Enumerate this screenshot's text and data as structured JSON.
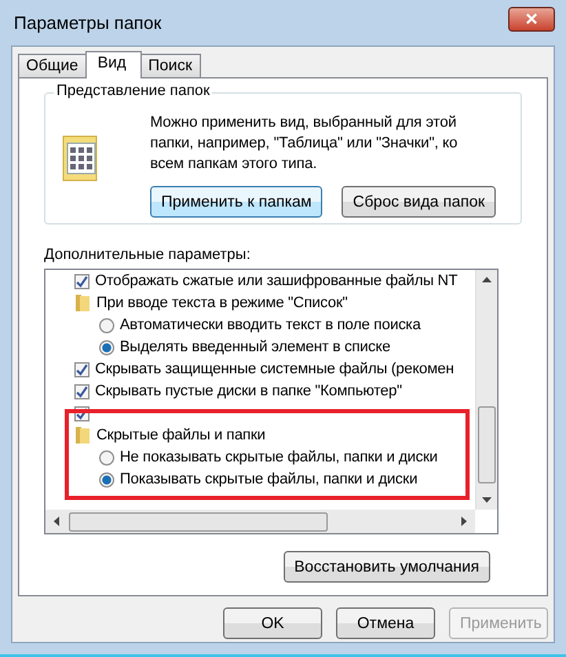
{
  "window": {
    "title": "Параметры папок",
    "close": "✕"
  },
  "tabs": [
    {
      "label": "Общие",
      "selected": false
    },
    {
      "label": "Вид",
      "selected": true
    },
    {
      "label": "Поиск",
      "selected": false
    }
  ],
  "folder_view": {
    "title": "Представление папок",
    "text": "Можно применить вид, выбранный для этой папки, например, \"Таблица\" или \"Значки\", ко всем папкам этого типа.",
    "buttons": [
      {
        "label": "Применить к папкам",
        "focused": true
      },
      {
        "label": "Сброс вида папок",
        "focused": false
      }
    ]
  },
  "advanced": {
    "label": "Дополнительные параметры:",
    "items": [
      {
        "kind": "checkbox",
        "label": "Отображать сжатые или зашифрованные файлы NT",
        "checked": true
      },
      {
        "kind": "folder",
        "label": "При вводе текста в режиме \"Список\"",
        "children": [
          {
            "kind": "radio",
            "label": "Автоматически вводить текст в поле поиска",
            "selected": false
          },
          {
            "kind": "radio",
            "label": "Выделять введенный элемент в списке",
            "selected": true
          }
        ]
      },
      {
        "kind": "checkbox",
        "label": "Скрывать защищенные системные файлы (рекомен",
        "checked": true
      },
      {
        "kind": "checkbox",
        "label": "Скрывать пустые диски в папке \"Компьютер\"",
        "checked": true
      },
      {
        "kind": "checkbox",
        "checked": true
      },
      {
        "kind": "folder",
        "label": "Скрытые файлы и папки",
        "children": [
          {
            "kind": "radio",
            "label": "Не показывать скрытые файлы, папки и диски",
            "selected": false
          },
          {
            "kind": "radio",
            "label": "Показывать скрытые файлы, папки и диски",
            "selected": true
          }
        ]
      }
    ],
    "restore": "Восстановить умолчания"
  },
  "buttons": [
    {
      "label": "OK",
      "disabled": false
    },
    {
      "label": "Отмена",
      "disabled": false
    },
    {
      "label": "Применить",
      "disabled": true
    }
  ]
}
